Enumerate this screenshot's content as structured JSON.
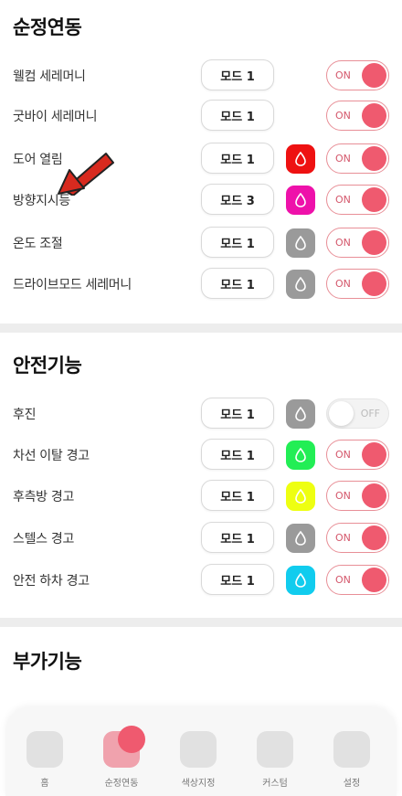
{
  "sections": [
    {
      "title": "순정연동",
      "rows": [
        {
          "label": "웰컴 세레머니",
          "mode": "모드 1",
          "color": null,
          "toggle": "ON",
          "on": true
        },
        {
          "label": "굿바이 세레머니",
          "mode": "모드 1",
          "color": null,
          "toggle": "ON",
          "on": true
        },
        {
          "label": "도어 열림",
          "mode": "모드 1",
          "color": "#ee1111",
          "toggle": "ON",
          "on": true
        },
        {
          "label": "방향지시등",
          "mode": "모드 3",
          "color": "#ee11aa",
          "toggle": "ON",
          "on": true
        },
        {
          "label": "온도 조절",
          "mode": "모드 1",
          "color": "#9a9a9a",
          "toggle": "ON",
          "on": true
        },
        {
          "label": "드라이브모드 세레머니",
          "mode": "모드 1",
          "color": "#9a9a9a",
          "toggle": "ON",
          "on": true
        }
      ]
    },
    {
      "title": "안전기능",
      "rows": [
        {
          "label": "후진",
          "mode": "모드 1",
          "color": "#9a9a9a",
          "toggle": "OFF",
          "on": false
        },
        {
          "label": "차선 이탈 경고",
          "mode": "모드 1",
          "color": "#22ee55",
          "toggle": "ON",
          "on": true
        },
        {
          "label": "후측방 경고",
          "mode": "모드 1",
          "color": "#eeff11",
          "toggle": "ON",
          "on": true
        },
        {
          "label": "스텔스 경고",
          "mode": "모드 1",
          "color": "#9a9a9a",
          "toggle": "ON",
          "on": true
        },
        {
          "label": "안전 하차 경고",
          "mode": "모드 1",
          "color": "#11ccee",
          "toggle": "ON",
          "on": true
        }
      ]
    },
    {
      "title": "부가기능",
      "rows": []
    }
  ],
  "nav": [
    {
      "label": "홈",
      "icon": "home-icon",
      "active": false
    },
    {
      "label": "순정연동",
      "icon": "link-icon",
      "active": true
    },
    {
      "label": "색상지정",
      "icon": "brush-icon",
      "active": false
    },
    {
      "label": "커스텀",
      "icon": "hand-icon",
      "active": false
    },
    {
      "label": "설정",
      "icon": "face-icon",
      "active": false
    }
  ],
  "colors": {
    "accent": "#ef5a6f",
    "accent_border": "#e88f97"
  }
}
